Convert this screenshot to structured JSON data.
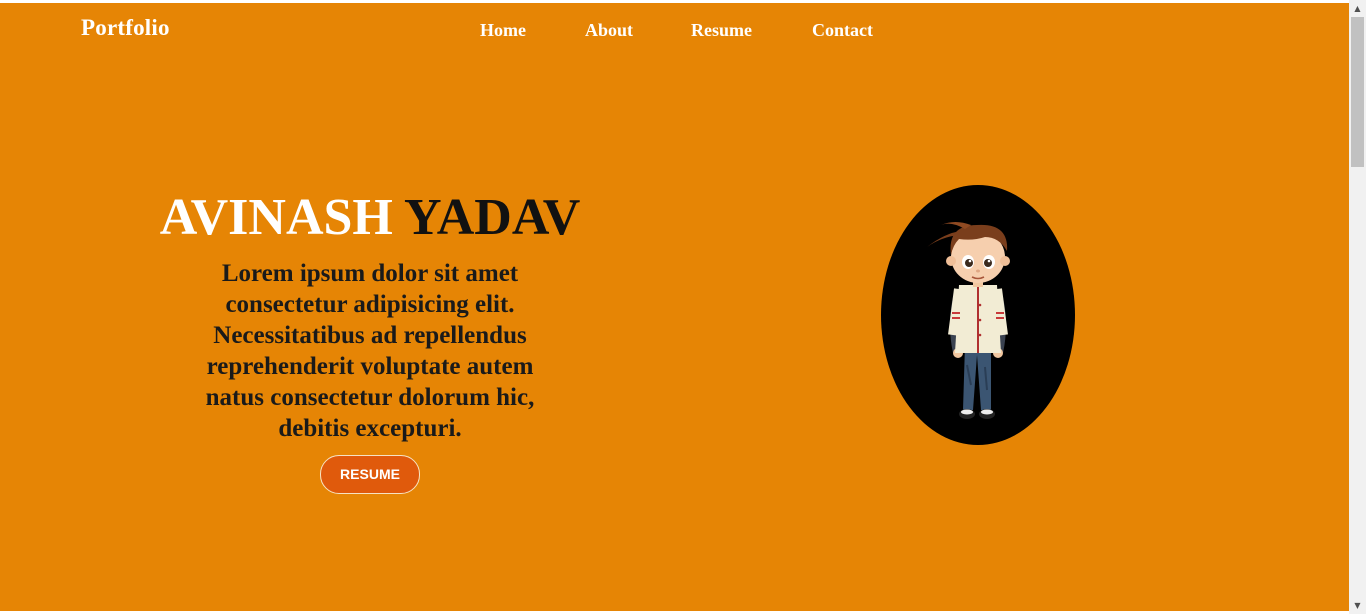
{
  "header": {
    "brand": "Portfolio",
    "nav": [
      {
        "label": "Home"
      },
      {
        "label": "About"
      },
      {
        "label": "Resume"
      },
      {
        "label": "Contact"
      }
    ]
  },
  "hero": {
    "first_name": "AVINASH",
    "last_name": "YADAV",
    "intro": "Lorem ipsum dolor sit amet consectetur adipisicing elit. Necessitatibus ad repellendus reprehenderit voluptate autem natus consectetur dolorum hic, debitis excepturi.",
    "button_label": "RESUME",
    "avatar_icon": "cartoon-boy-avatar"
  },
  "colors": {
    "background": "#e68505",
    "button": "#e05a0c",
    "first_name": "#ffffff",
    "last_name": "#111111"
  },
  "scrollbar": {
    "up_icon": "▲",
    "down_icon": "▼"
  }
}
